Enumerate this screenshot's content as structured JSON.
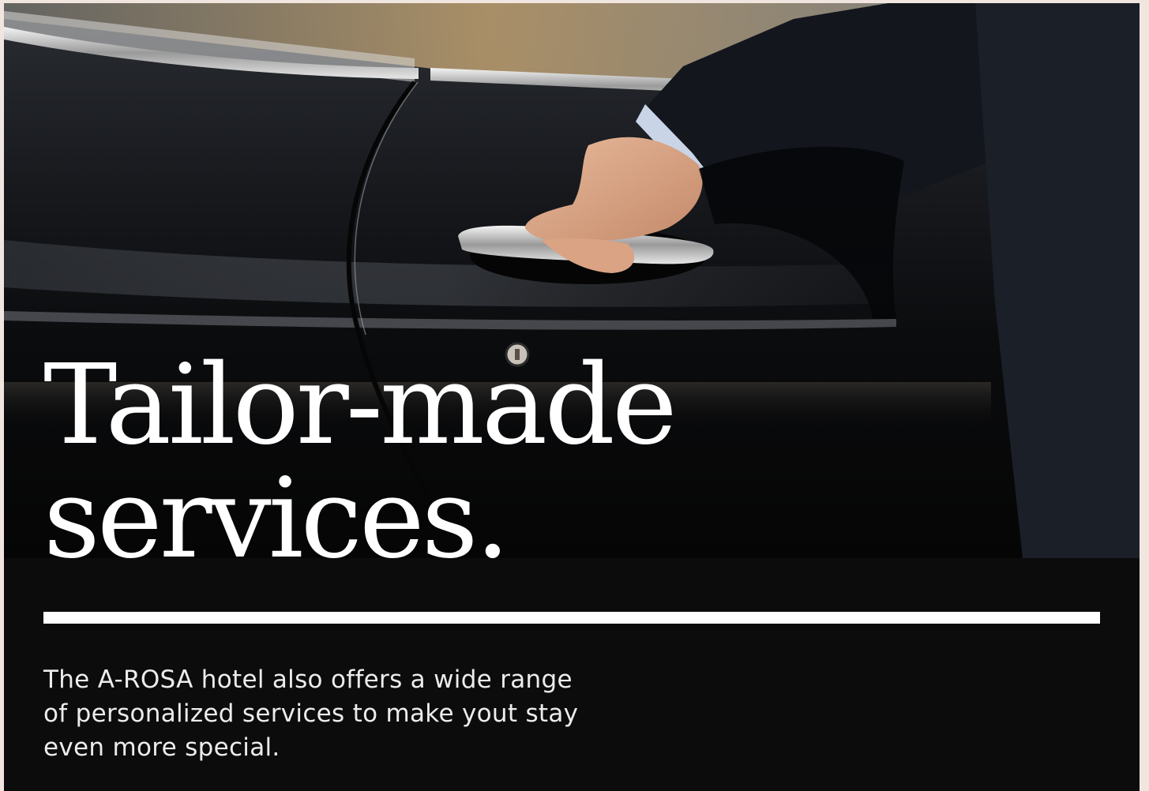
{
  "hero": {
    "image_alt": "Chauffeur opening black car door",
    "headline_line1": "Tailor-made",
    "headline_line2": "services."
  },
  "description": {
    "line1": "The A-ROSA hotel also offers a wide range",
    "line2": "of personalized services to make yout stay",
    "line3": "even more special."
  },
  "colors": {
    "background": "#0c0c0c",
    "page_edge": "#f1e6df",
    "text": "#ffffff"
  }
}
